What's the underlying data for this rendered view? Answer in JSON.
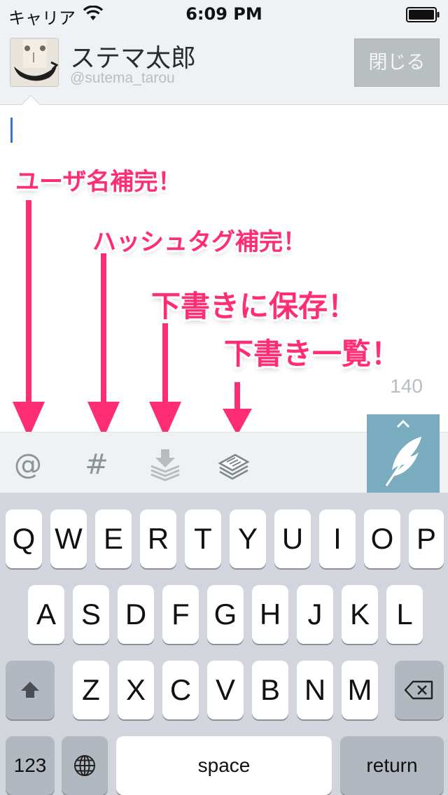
{
  "status_bar": {
    "carrier": "キャリア",
    "time": "6:09 PM"
  },
  "header": {
    "display_name": "ステマ太郎",
    "screen_name": "@sutema_tarou",
    "close_label": "閉じる"
  },
  "compose": {
    "char_count": "140"
  },
  "annotations": {
    "username_completion": "ユーザ名補完！",
    "hashtag_completion": "ハッシュタグ補完！",
    "save_draft": "下書きに保存！",
    "draft_list": "下書き一覧！"
  },
  "toolbar": {
    "mention_symbol": "@",
    "hashtag_symbol": "#"
  },
  "keyboard": {
    "row1": [
      "Q",
      "W",
      "E",
      "R",
      "T",
      "Y",
      "U",
      "I",
      "O",
      "P"
    ],
    "row2": [
      "A",
      "S",
      "D",
      "F",
      "G",
      "H",
      "J",
      "K",
      "L"
    ],
    "row3": [
      "Z",
      "X",
      "C",
      "V",
      "B",
      "N",
      "M"
    ],
    "numbers_label": "123",
    "space_label": "space",
    "return_label": "return"
  },
  "icons": {
    "status": [
      "wifi-icon",
      "battery-icon"
    ],
    "toolbar": [
      "save-draft-icon",
      "draft-list-icon",
      "feather-icon"
    ],
    "keyboard": [
      "shift-icon",
      "delete-icon",
      "globe-icon"
    ]
  },
  "colors": {
    "annotation": "#ff2d74",
    "tweet_button": "#7aacbf",
    "cursor": "#3a6fe0",
    "header_background": "#eef2f4"
  }
}
